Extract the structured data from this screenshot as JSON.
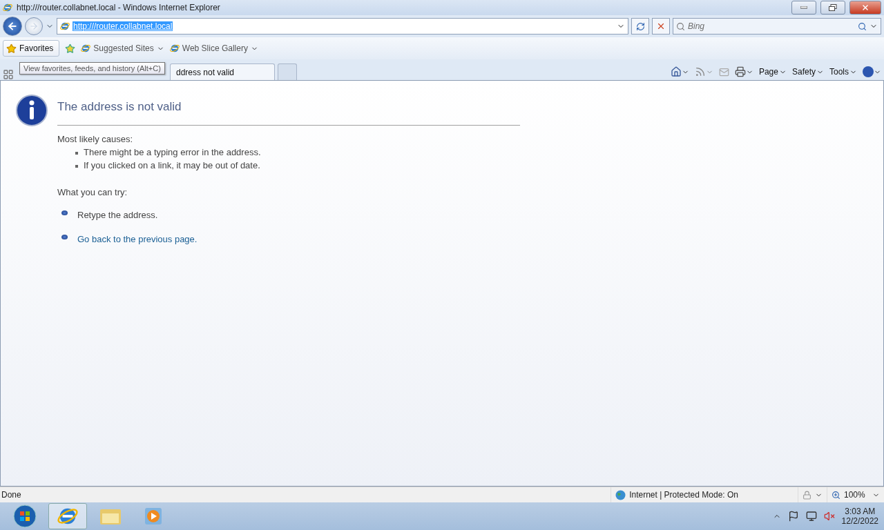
{
  "window": {
    "title": "http:///router.collabnet.local - Windows Internet Explorer"
  },
  "navigation": {
    "address": "http:///router.collabnet.local",
    "search_placeholder": "Bing"
  },
  "favorites_bar": {
    "favorites_label": "Favorites",
    "items": [
      "Suggested Sites",
      "Web Slice Gallery"
    ]
  },
  "tooltip": "View favorites, feeds, and history (Alt+C)",
  "tabs": [
    {
      "label": "ddress not valid",
      "selected": true
    }
  ],
  "command_bar": [
    "Page",
    "Safety",
    "Tools"
  ],
  "page": {
    "title": "The address is not valid",
    "causes_heading": "Most likely causes:",
    "causes": [
      "There might be a typing error in the address.",
      "If you clicked on a link, it may be out of date."
    ],
    "try_heading": "What you can try:",
    "suggestions": [
      {
        "text": "Retype the address.",
        "kind": "text"
      },
      {
        "text": "Go back to the previous page.",
        "kind": "link"
      }
    ]
  },
  "status_bar": {
    "status": "Done",
    "zone": "Internet | Protected Mode: On",
    "zoom": "100%"
  },
  "taskbar": {
    "time": "3:03 AM",
    "date": "12/2/2022"
  }
}
